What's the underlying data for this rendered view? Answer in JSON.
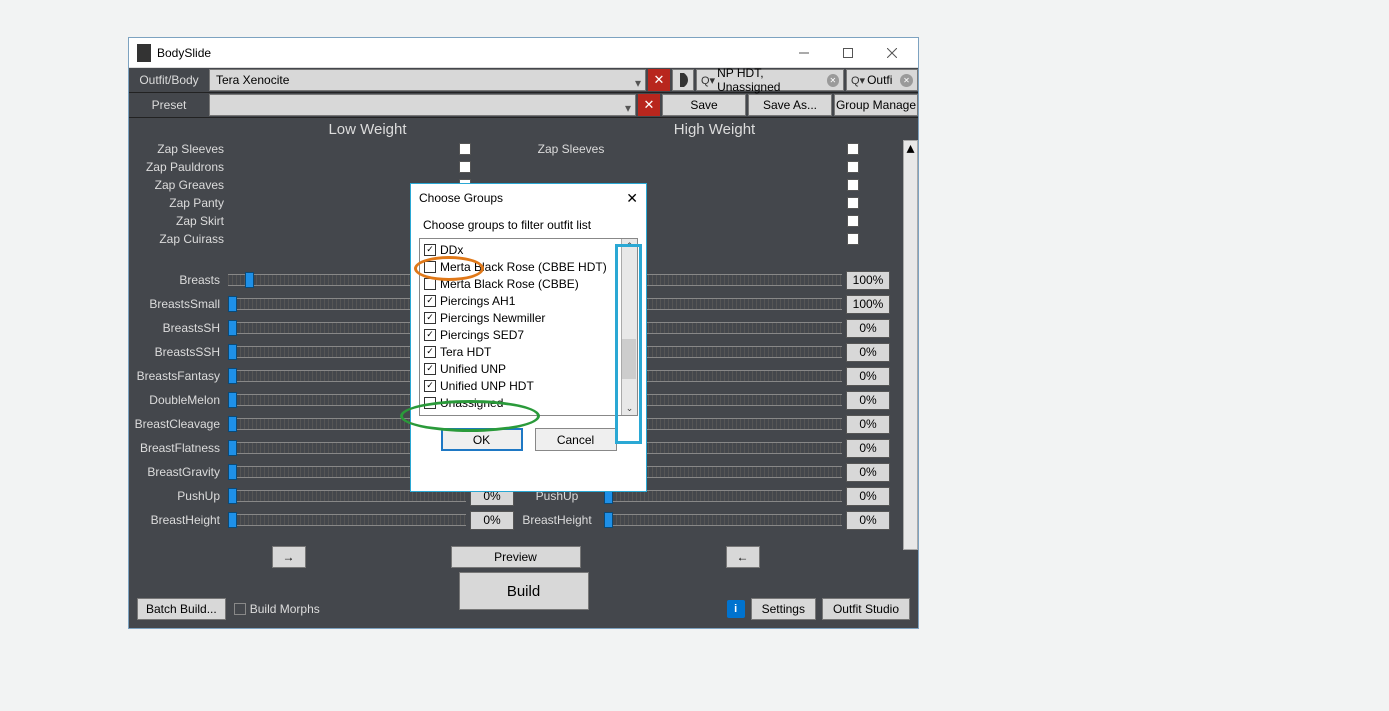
{
  "window": {
    "title": "BodySlide",
    "outfit_label": "Outfit/Body",
    "outfit_value": "Tera Xenocite",
    "preset_label": "Preset",
    "preset_value": "",
    "filter1": "NP HDT, Unassigned",
    "filter2": "Outfi",
    "save": "Save",
    "saveas": "Save As...",
    "groupmgr": "Group Manage"
  },
  "headers": {
    "low": "Low Weight",
    "high": "High Weight"
  },
  "zaps": [
    "Zap Sleeves",
    "Zap Pauldrons",
    "Zap Greaves",
    "Zap Panty",
    "Zap Skirt",
    "Zap Cuirass"
  ],
  "zap_right_top": "Zap Sleeves",
  "sliders": [
    {
      "name": "Breasts",
      "l": 17,
      "lv": "",
      "r": 18,
      "rv": "100%"
    },
    {
      "name": "BreastsSmall",
      "l": 0,
      "lv": "",
      "r": 18,
      "rv": "100%"
    },
    {
      "name": "BreastsSH",
      "l": 0,
      "lv": "",
      "r": 0,
      "rv": "0%"
    },
    {
      "name": "BreastsSSH",
      "l": 0,
      "lv": "",
      "r": 0,
      "rv": "0%"
    },
    {
      "name": "BreastsFantasy",
      "l": 0,
      "lv": "",
      "r": 0,
      "rv": "0%"
    },
    {
      "name": "DoubleMelon",
      "l": 0,
      "lv": "",
      "r": 0,
      "rv": "0%"
    },
    {
      "name": "BreastCleavage",
      "l": 0,
      "lv": "",
      "r": 0,
      "rv": "0%"
    },
    {
      "name": "BreastFlatness",
      "l": 0,
      "lv": "",
      "r": 0,
      "rv": "0%"
    },
    {
      "name": "BreastGravity",
      "l": 0,
      "lv": "",
      "r": 0,
      "rv": "0%"
    },
    {
      "name": "PushUp",
      "l": 0,
      "lv": "0%",
      "r": 0,
      "rv": "0%"
    },
    {
      "name": "BreastHeight",
      "l": 0,
      "lv": "0%",
      "r": 0,
      "rv": "0%"
    }
  ],
  "mid": {
    "left": "→",
    "preview": "Preview",
    "right": "←"
  },
  "footer": {
    "batch": "Batch Build...",
    "morph": "Build Morphs",
    "build": "Build",
    "settings": "Settings",
    "studio": "Outfit Studio"
  },
  "dialog": {
    "title": "Choose Groups",
    "close": "✕",
    "subtitle": "Choose groups to filter outfit list",
    "items": [
      {
        "label": "DDx",
        "checked": true
      },
      {
        "label": "Merta Black Rose (CBBE HDT)",
        "checked": false
      },
      {
        "label": "Merta Black Rose (CBBE)",
        "checked": false
      },
      {
        "label": "Piercings AH1",
        "checked": true
      },
      {
        "label": "Piercings Newmiller",
        "checked": true
      },
      {
        "label": "Piercings SED7",
        "checked": true
      },
      {
        "label": "Tera HDT",
        "checked": true
      },
      {
        "label": "Unified UNP",
        "checked": true
      },
      {
        "label": "Unified UNP HDT",
        "checked": true
      },
      {
        "label": "Unassigned",
        "checked": false
      }
    ],
    "ok": "OK",
    "cancel": "Cancel"
  },
  "pushup_mid": "PushUp",
  "bh_mid": "BreastHeight"
}
